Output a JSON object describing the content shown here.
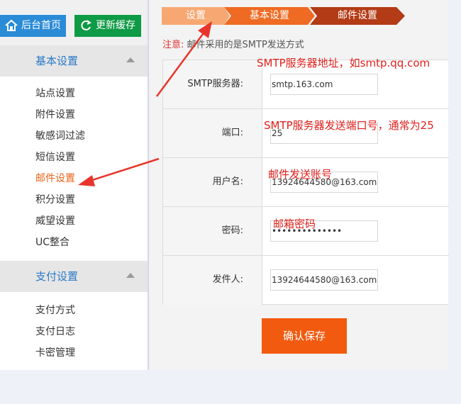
{
  "sidebar": {
    "home_button": "后台首页",
    "cache_button": "更新缓存",
    "sections": [
      {
        "title": "基本设置",
        "items": [
          "站点设置",
          "附件设置",
          "敏感词过滤",
          "短信设置",
          "邮件设置",
          "积分设置",
          "威望设置",
          "UC整合"
        ]
      },
      {
        "title": "支付设置",
        "items": [
          "支付方式",
          "支付日志",
          "卡密管理"
        ]
      }
    ],
    "active_item": "邮件设置"
  },
  "breadcrumb": [
    "设置",
    "基本设置",
    "邮件设置"
  ],
  "notice": {
    "label": "注意:",
    "text": "邮件采用的是SMTP发送方式"
  },
  "form": {
    "rows": [
      {
        "label": "SMTP服务器:",
        "value": "smtp.163.com"
      },
      {
        "label": "端口:",
        "value": "25"
      },
      {
        "label": "用户名:",
        "value": "13924644580@163.com"
      },
      {
        "label": "密码:",
        "value": "••••••••••••••"
      },
      {
        "label": "发件人:",
        "value": "13924644580@163.com"
      }
    ],
    "save_button": "确认保存"
  },
  "annotations": {
    "smtp": "SMTP服务器地址，如smtp.qq.com",
    "port": "SMTP服务器发送端口号，通常为25",
    "user": "邮件发送账号",
    "password": "邮箱密码"
  },
  "colors": {
    "accent_orange": "#ef6a22",
    "annotation_red": "#e0211c",
    "link_blue": "#2a7ac7"
  }
}
